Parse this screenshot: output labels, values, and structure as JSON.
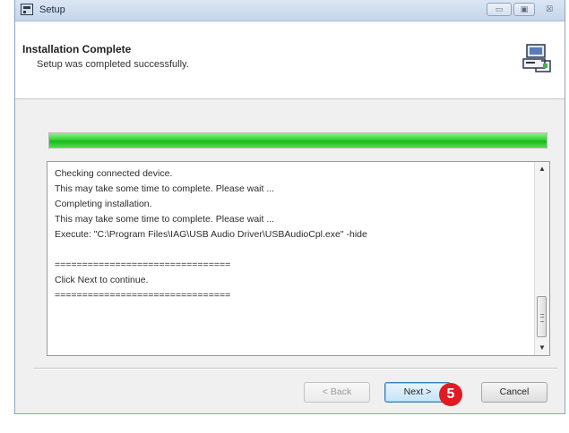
{
  "window": {
    "title": "Setup",
    "controls": {
      "minimize": "▭",
      "maximize": "▣",
      "close": "☒"
    }
  },
  "header": {
    "title": "Installation Complete",
    "subtitle": "Setup was completed successfully."
  },
  "progress": {
    "fraction": 1.0,
    "color": "#22c722"
  },
  "log": {
    "lines": [
      "Checking connected device.",
      "This may take some time to complete. Please wait ...",
      "Completing installation.",
      "This may take some time to complete. Please wait ...",
      "Execute: \"C:\\Program Files\\IAG\\USB Audio Driver\\USBAudioCpl.exe\" -hide",
      "",
      "================================",
      "Click Next to continue.",
      "================================"
    ]
  },
  "buttons": {
    "back": "< Back",
    "next": "Next >",
    "cancel": "Cancel"
  },
  "step_badge": {
    "number": "5",
    "color": "#e11b22"
  }
}
